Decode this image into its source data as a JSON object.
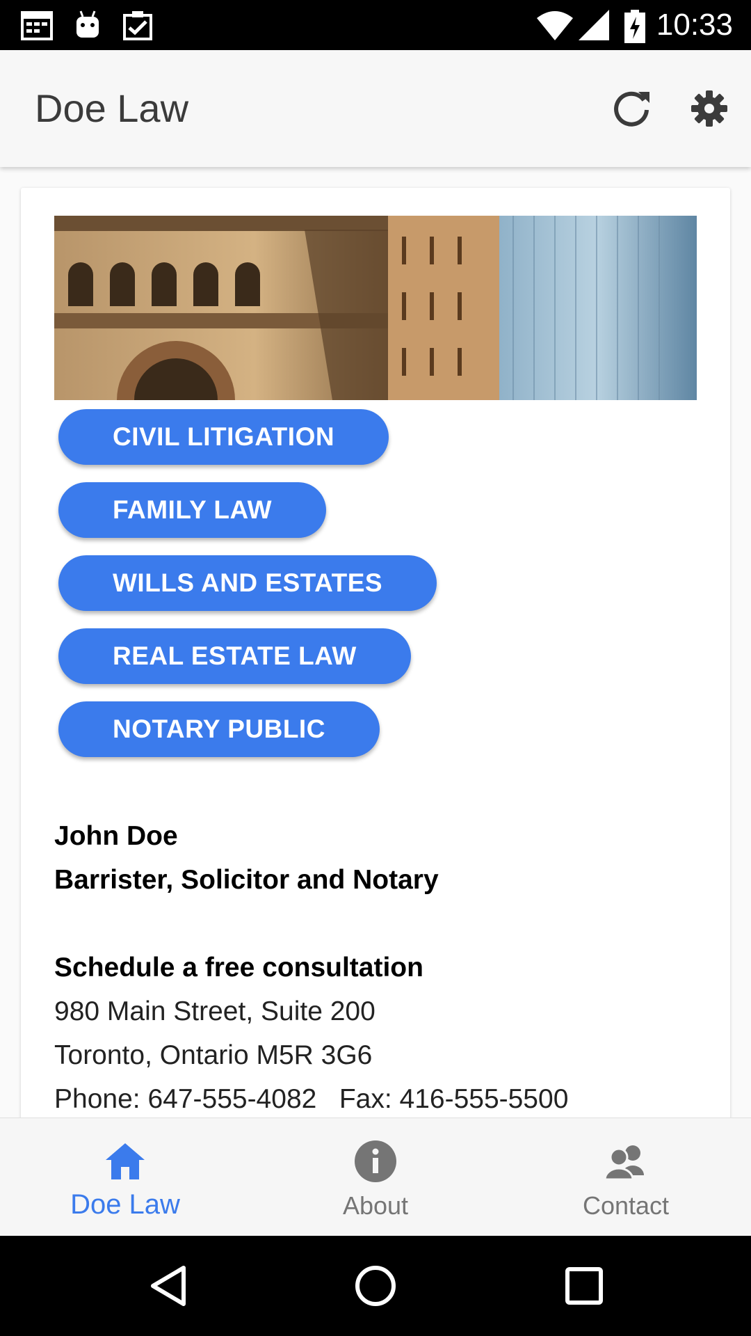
{
  "status_bar": {
    "time": "10:33",
    "icons": [
      "calendar-icon",
      "android-icon",
      "clipboard-check-icon",
      "wifi-icon",
      "signal-icon",
      "battery-charging-icon"
    ]
  },
  "app_bar": {
    "title": "Doe Law",
    "actions": [
      "refresh-icon",
      "settings-gear-icon"
    ]
  },
  "services": [
    {
      "label": "CIVIL LITIGATION"
    },
    {
      "label": "FAMILY LAW"
    },
    {
      "label": "WILLS AND ESTATES"
    },
    {
      "label": "REAL ESTATE LAW"
    },
    {
      "label": "NOTARY PUBLIC"
    }
  ],
  "profile": {
    "name": "John Doe",
    "title": "Barrister, Solicitor and Notary"
  },
  "contact": {
    "heading": "Schedule a free consultation",
    "address_line1": "980 Main Street, Suite 200",
    "address_line2": "Toronto, Ontario M5R 3G6",
    "phone_fax": "Phone: 647-555-4082   Fax: 416-555-5500"
  },
  "bottom_nav": {
    "items": [
      {
        "label": "Doe Law",
        "icon": "home-icon",
        "active": true
      },
      {
        "label": "About",
        "icon": "info-icon",
        "active": false
      },
      {
        "label": "Contact",
        "icon": "contacts-icon",
        "active": false
      }
    ]
  },
  "colors": {
    "accent": "#3b7bec",
    "app_bar": "#f7f7f7",
    "inactive_nav": "#757575"
  }
}
